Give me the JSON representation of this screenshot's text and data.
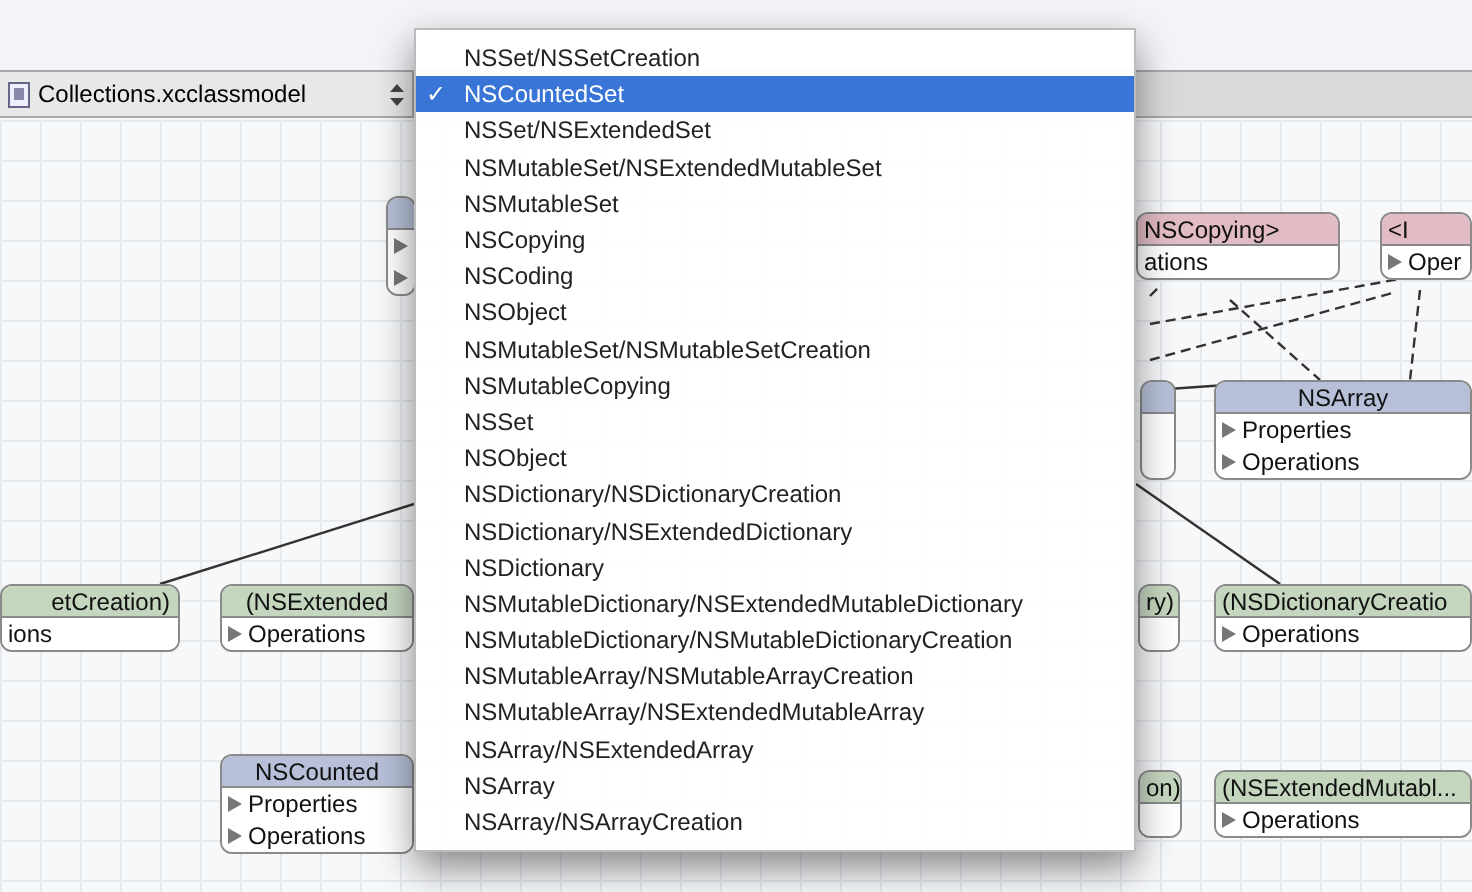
{
  "toolbar": {
    "file_popup": "Collections.xcclassmodel"
  },
  "nodes": [
    {
      "kind": "category",
      "title": "etCreation)",
      "rows": [
        "ions"
      ],
      "arrows": false
    },
    {
      "kind": "category",
      "title": "(NSExtended",
      "rows": [
        "Operations"
      ],
      "arrows": true
    },
    {
      "kind": "class",
      "title": "NSCounted",
      "rows": [
        "Properties",
        "Operations"
      ],
      "arrows": true
    },
    {
      "kind": "class",
      "rows": [
        "",
        ""
      ],
      "arrows": true
    },
    {
      "kind": "protocol",
      "title": "NSCopying>",
      "rows": [
        "ations"
      ],
      "arrows": false
    },
    {
      "kind": "protocol",
      "title": "<I",
      "rows": [
        "Oper"
      ],
      "arrows": true
    },
    {
      "kind": "class",
      "rows": [
        "",
        ""
      ],
      "arrows": false
    },
    {
      "kind": "class",
      "title": "NSArray",
      "rows": [
        "Properties",
        "Operations"
      ],
      "arrows": true
    },
    {
      "kind": "category",
      "title": "ry)",
      "rows": [
        ""
      ],
      "arrows": false
    },
    {
      "kind": "category",
      "title": "(NSDictionaryCreatio",
      "rows": [
        "Operations"
      ],
      "arrows": true
    },
    {
      "kind": "category",
      "title": "on)",
      "rows": [
        ""
      ],
      "arrows": false
    },
    {
      "kind": "category",
      "title": "(NSExtendedMutabl...",
      "rows": [
        "Operations"
      ],
      "arrows": true
    }
  ],
  "menu": {
    "check": "✓",
    "items": [
      {
        "label": "NSSet/NSSetCreation",
        "selected": false
      },
      {
        "label": "NSCountedSet",
        "selected": true
      },
      {
        "label": "NSSet/NSExtendedSet",
        "selected": false
      },
      {
        "label": "NSMutableSet/NSExtendedMutableSet",
        "selected": false
      },
      {
        "label": "NSMutableSet",
        "selected": false
      },
      {
        "label": "NSCopying",
        "selected": false
      },
      {
        "label": "NSCoding",
        "selected": false
      },
      {
        "label": "NSObject",
        "selected": false
      },
      {
        "label": "NSMutableSet/NSMutableSetCreation",
        "selected": false
      },
      {
        "label": "NSMutableCopying",
        "selected": false
      },
      {
        "label": "NSSet",
        "selected": false
      },
      {
        "label": "NSObject",
        "selected": false
      },
      {
        "label": "NSDictionary/NSDictionaryCreation",
        "selected": false
      },
      {
        "label": "NSDictionary/NSExtendedDictionary",
        "selected": false
      },
      {
        "label": "NSDictionary",
        "selected": false
      },
      {
        "label": "NSMutableDictionary/NSExtendedMutableDictionary",
        "selected": false
      },
      {
        "label": "NSMutableDictionary/NSMutableDictionaryCreation",
        "selected": false
      },
      {
        "label": "NSMutableArray/NSMutableArrayCreation",
        "selected": false
      },
      {
        "label": "NSMutableArray/NSExtendedMutableArray",
        "selected": false
      },
      {
        "label": "NSArray/NSExtendedArray",
        "selected": false
      },
      {
        "label": "NSArray",
        "selected": false
      },
      {
        "label": "NSArray/NSArrayCreation",
        "selected": false
      }
    ]
  }
}
